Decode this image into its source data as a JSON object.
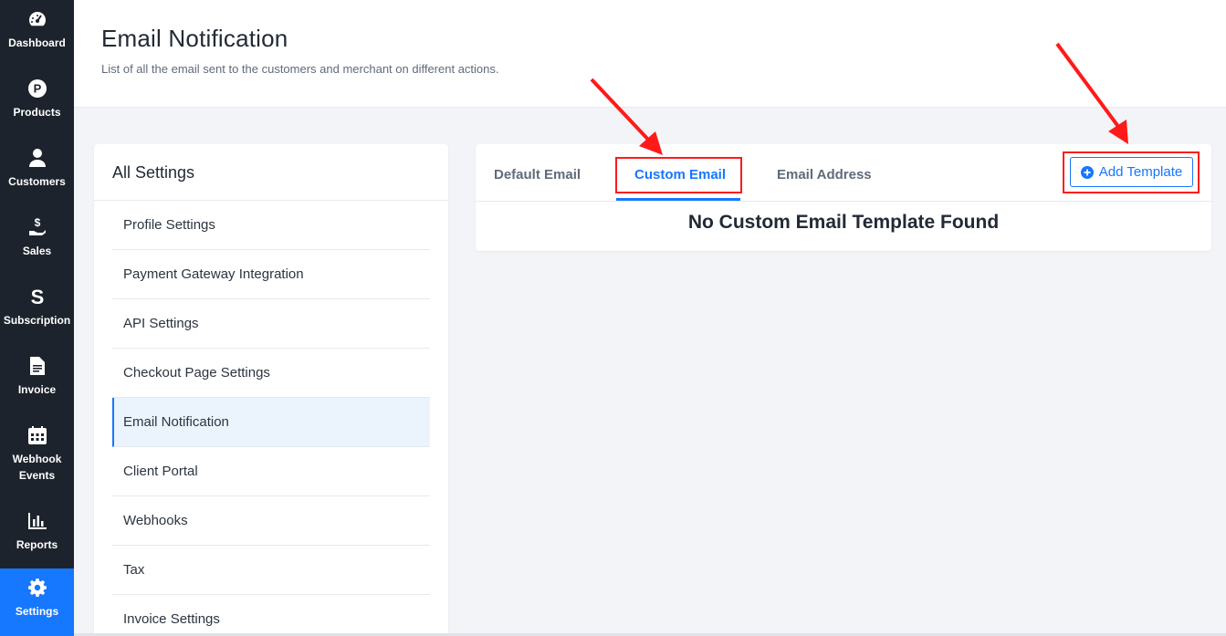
{
  "sidebar": {
    "items": [
      {
        "label": "Dashboard",
        "icon": "speedometer-icon"
      },
      {
        "label": "Products",
        "icon": "p-circle-icon"
      },
      {
        "label": "Customers",
        "icon": "user-icon"
      },
      {
        "label": "Sales",
        "icon": "dollar-hand-icon"
      },
      {
        "label": "Subscription",
        "icon": "s-icon"
      },
      {
        "label": "Invoice",
        "icon": "document-icon"
      },
      {
        "label": "Webhook Events",
        "icon": "calendar-icon"
      },
      {
        "label": "Reports",
        "icon": "bar-chart-icon"
      },
      {
        "label": "Settings",
        "icon": "gear-icon",
        "active": true
      }
    ]
  },
  "header": {
    "title": "Email Notification",
    "subtitle": "List of all the email sent to the customers and merchant on different actions."
  },
  "settings": {
    "title": "All Settings",
    "items": [
      "Profile Settings",
      "Payment Gateway Integration",
      "API Settings",
      "Checkout Page Settings",
      "Email Notification",
      "Client Portal",
      "Webhooks",
      "Tax",
      "Invoice Settings"
    ],
    "active": "Email Notification"
  },
  "content": {
    "tabs": [
      "Default Email",
      "Custom Email",
      "Email Address"
    ],
    "active_tab": "Custom Email",
    "add_button_label": "Add Template",
    "empty_message": "No Custom Email Template Found"
  },
  "colors": {
    "sidebar_bg": "#1d232c",
    "accent": "#1677ff",
    "annotation": "#ff1a1a"
  }
}
